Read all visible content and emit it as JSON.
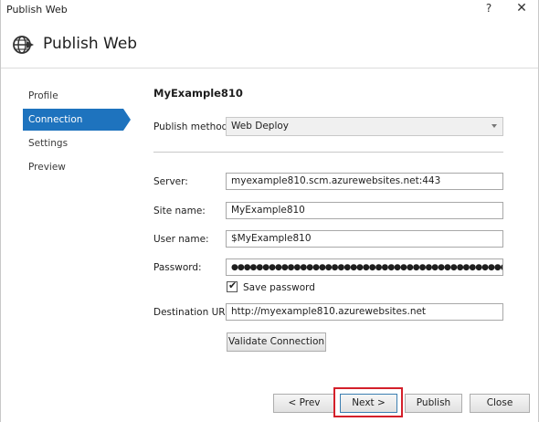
{
  "window": {
    "title": "Publish Web",
    "help_glyph": "?",
    "close_glyph": "✕"
  },
  "header": {
    "title": "Publish Web",
    "icon": "globe-publish-icon"
  },
  "nav": {
    "items": [
      {
        "label": "Profile",
        "active": false
      },
      {
        "label": "Connection",
        "active": true
      },
      {
        "label": "Settings",
        "active": false
      },
      {
        "label": "Preview",
        "active": false
      }
    ]
  },
  "connection": {
    "profile_name": "MyExample810",
    "publish_method": {
      "label": "Publish method:",
      "value": "Web Deploy"
    },
    "server": {
      "label": "Server:",
      "value": "myexample810.scm.azurewebsites.net:443"
    },
    "site_name": {
      "label": "Site name:",
      "value": "MyExample810"
    },
    "user_name": {
      "label": "User name:",
      "value": "$MyExample810"
    },
    "password": {
      "label": "Password:",
      "value": "●●●●●●●●●●●●●●●●●●●●●●●●●●●●●●●●●●●●●●●●●●●●●●●●●●●●●●●●●●●●"
    },
    "save_password": {
      "label": "Save password",
      "checked": true
    },
    "destination_url": {
      "label": "Destination URL:",
      "value": "http://myexample810.azurewebsites.net"
    },
    "validate_button": "Validate Connection"
  },
  "footer": {
    "prev_button": "< Prev",
    "next_button": "Next >",
    "publish_button": "Publish",
    "close_button": "Close"
  },
  "colors": {
    "accent": "#1e73be",
    "highlight": "#d4202a"
  }
}
